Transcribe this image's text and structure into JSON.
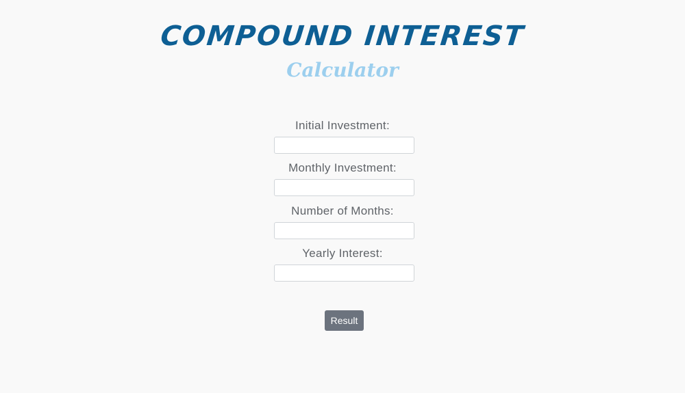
{
  "header": {
    "title": "COMPOUND INTEREST",
    "subtitle": "Calculator"
  },
  "form": {
    "fields": [
      {
        "label": "Initial Investment:",
        "value": ""
      },
      {
        "label": "Monthly Investment:",
        "value": ""
      },
      {
        "label": "Number of Months:",
        "value": ""
      },
      {
        "label": "Yearly Interest:",
        "value": ""
      }
    ],
    "submit_label": "Result"
  },
  "colors": {
    "background": "#f9f9f9",
    "title": "#0e5f94",
    "subtitle": "#9ccfee",
    "button": "#6c737e"
  }
}
